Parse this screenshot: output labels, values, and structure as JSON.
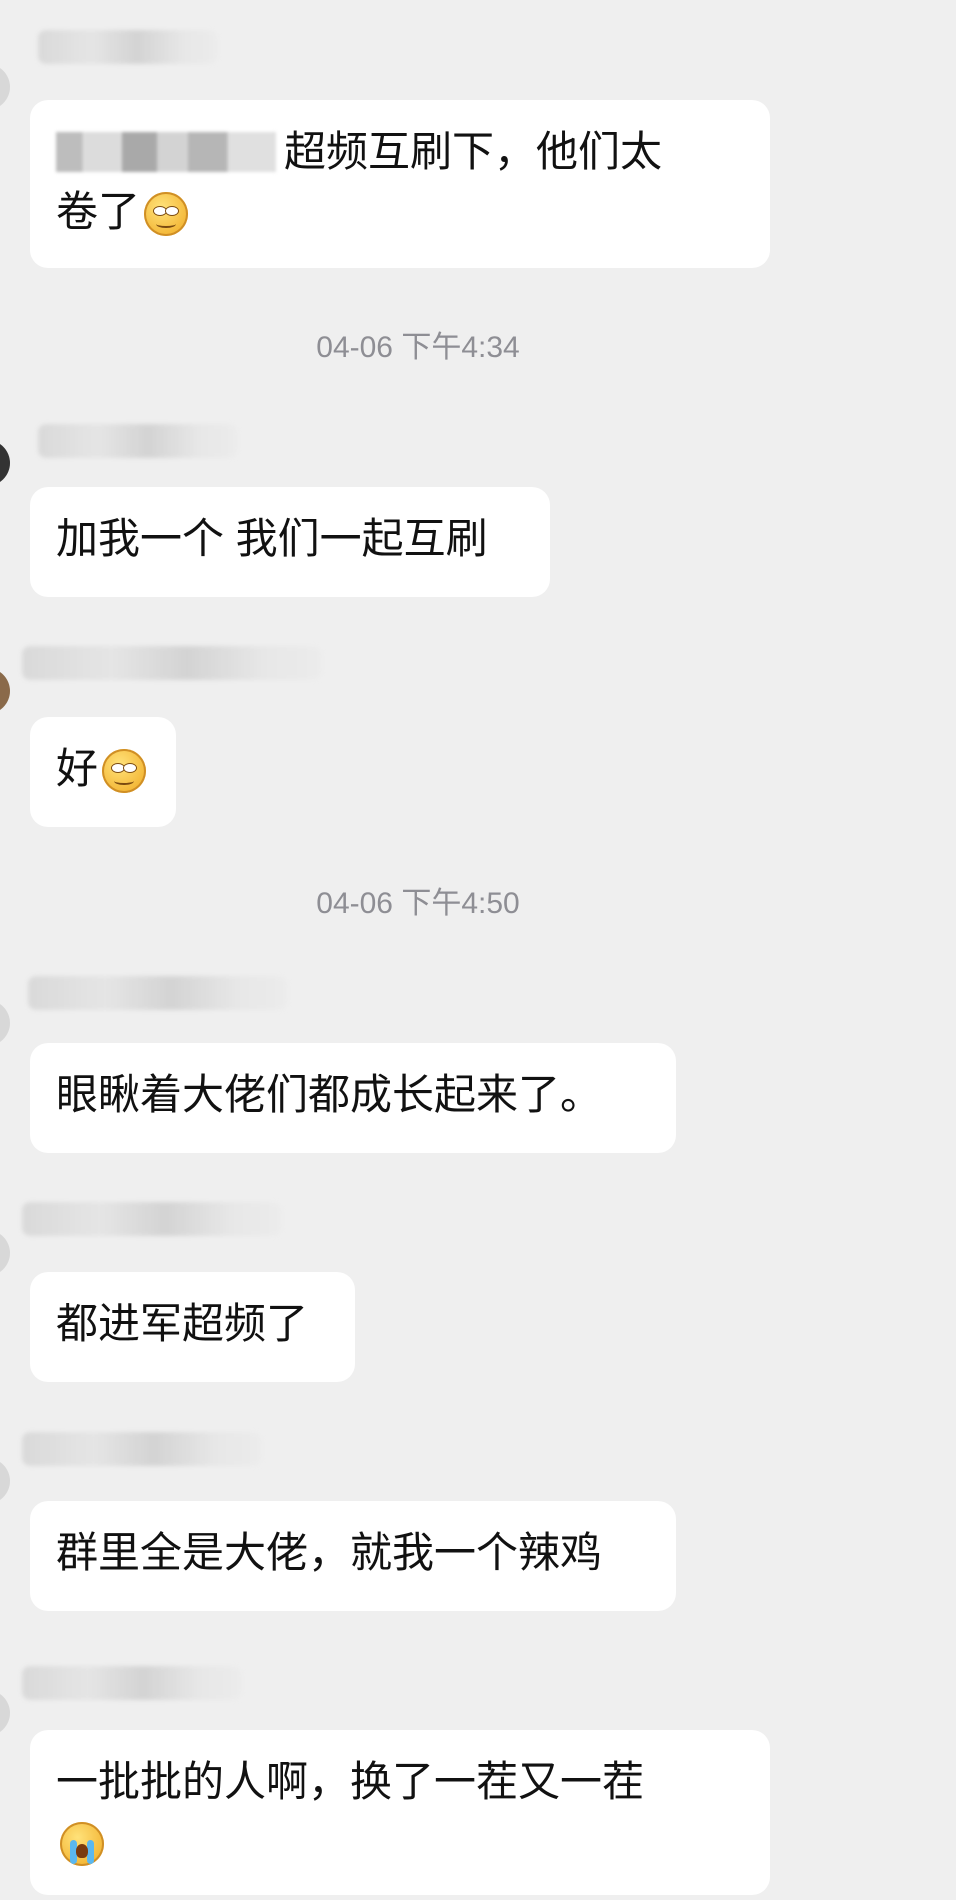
{
  "chat": {
    "timestamps": [
      "04-06 下午4:34",
      "04-06 下午4:50"
    ],
    "messages": [
      {
        "text": "超频互刷下，他们太",
        "text2": "卷了",
        "emoji": "smirk-emoji"
      },
      {
        "text": "加我一个 我们一起互刷"
      },
      {
        "text": "好",
        "emoji": "smirk-emoji"
      },
      {
        "text": "眼瞅着大佬们都成长起来了。"
      },
      {
        "text": "都进军超频了"
      },
      {
        "text": "群里全是大佬，就我一个辣鸡"
      },
      {
        "text": "一批批的人啊，换了一茬又一茬",
        "emoji": "crying-emoji"
      }
    ]
  }
}
